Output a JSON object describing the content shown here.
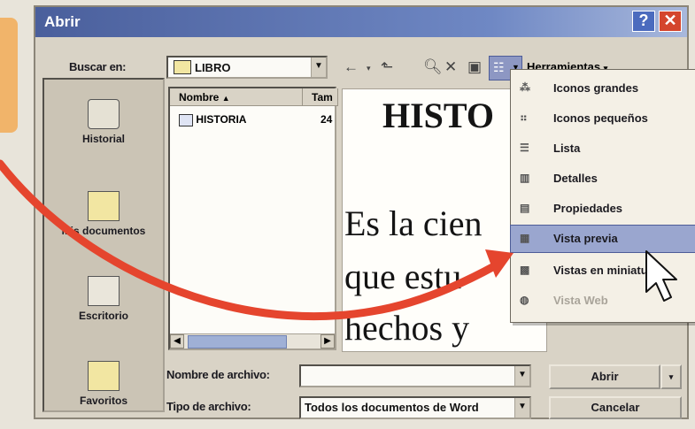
{
  "dialog": {
    "title": "Abrir",
    "help_label": "?",
    "close_label": "✕"
  },
  "lookin": {
    "label": "Buscar en:",
    "value": "LIBRO"
  },
  "toolbar": {
    "tools_label": "Herramientas"
  },
  "places": [
    {
      "label": "Historial"
    },
    {
      "label": "Mis documentos"
    },
    {
      "label": "Escritorio"
    },
    {
      "label": "Favoritos"
    }
  ],
  "filelist": {
    "col_name": "Nombre",
    "col_size": "Tam",
    "files": [
      {
        "name": "HISTORIA",
        "size": "24"
      }
    ]
  },
  "preview": {
    "heading": "HISTO",
    "lines": [
      "Es la cien",
      "que estu",
      "hechos y"
    ]
  },
  "views_menu": {
    "items": [
      {
        "label": "Iconos grandes"
      },
      {
        "label": "Iconos pequeños"
      },
      {
        "label": "Lista"
      },
      {
        "label": "Detalles"
      },
      {
        "label": "Propiedades"
      },
      {
        "label": "Vista previa"
      },
      {
        "label": "Vistas en miniatura"
      },
      {
        "label": "Vista Web"
      }
    ]
  },
  "filename": {
    "label": "Nombre de archivo:",
    "value": ""
  },
  "filetype": {
    "label": "Tipo de archivo:",
    "value": "Todos los documentos de Word"
  },
  "buttons": {
    "open": "Abrir",
    "cancel": "Cancelar"
  },
  "colors": {
    "title_bar": "#4a5f9c",
    "menu_highlight": "#9aa6cf",
    "arrow": "#e5452e"
  }
}
